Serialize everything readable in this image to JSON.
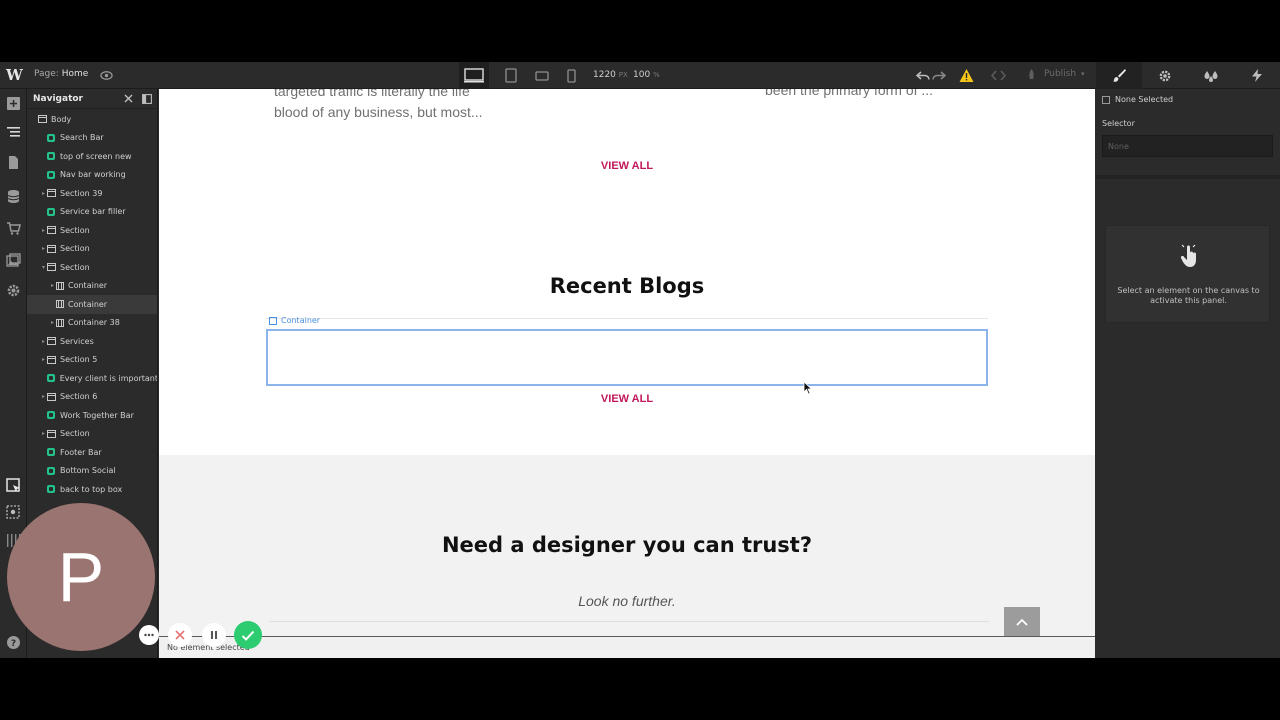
{
  "topbar": {
    "logo": "W",
    "page_prefix": "Page:",
    "page_name": "Home",
    "width_value": "1220",
    "width_unit": "PX",
    "zoom_value": "100",
    "zoom_unit": "%",
    "publish_label": "Publish"
  },
  "navigator": {
    "title": "Navigator",
    "items": [
      {
        "label": "Body",
        "type": "box",
        "depth": 0,
        "caret": false
      },
      {
        "label": "Search Bar",
        "type": "symbol",
        "depth": 1,
        "caret": false
      },
      {
        "label": "top of screen new",
        "type": "symbol",
        "depth": 1,
        "caret": false
      },
      {
        "label": "Nav bar working",
        "type": "symbol",
        "depth": 1,
        "caret": false
      },
      {
        "label": "Section 39",
        "type": "box",
        "depth": 1,
        "caret": true
      },
      {
        "label": "Service bar filler",
        "type": "symbol",
        "depth": 1,
        "caret": false
      },
      {
        "label": "Section",
        "type": "box",
        "depth": 1,
        "caret": true
      },
      {
        "label": "Section",
        "type": "box",
        "depth": 1,
        "caret": true
      },
      {
        "label": "Section",
        "type": "box",
        "depth": 1,
        "caret": true,
        "open": true
      },
      {
        "label": "Container",
        "type": "container",
        "depth": 2,
        "caret": true
      },
      {
        "label": "Container",
        "type": "container",
        "depth": 2,
        "caret": false,
        "selected": true
      },
      {
        "label": "Container 38",
        "type": "container",
        "depth": 2,
        "caret": true
      },
      {
        "label": "Services",
        "type": "box",
        "depth": 1,
        "caret": true
      },
      {
        "label": "Section 5",
        "type": "box",
        "depth": 1,
        "caret": true
      },
      {
        "label": "Every client is important",
        "type": "symbol",
        "depth": 1,
        "caret": false
      },
      {
        "label": "Section 6",
        "type": "box",
        "depth": 1,
        "caret": true
      },
      {
        "label": "Work Together Bar",
        "type": "symbol",
        "depth": 1,
        "caret": false
      },
      {
        "label": "Section",
        "type": "box",
        "depth": 1,
        "caret": true
      },
      {
        "label": "Footer Bar",
        "type": "symbol",
        "depth": 1,
        "caret": false
      },
      {
        "label": "Bottom Social",
        "type": "symbol",
        "depth": 1,
        "caret": false
      },
      {
        "label": "back to top box",
        "type": "symbol",
        "depth": 1,
        "caret": false
      }
    ]
  },
  "canvas": {
    "fragment_left_1": "targeted traffic is literally the life",
    "fragment_left_2": "blood of any business, but most...",
    "fragment_right": "been the primary form of ...",
    "view_all_1": "VIEW ALL",
    "recent_blogs": "Recent Blogs",
    "container_tag": "Container",
    "view_all_2": "VIEW ALL",
    "cta_heading": "Need a designer you can trust?",
    "cta_sub": "Look no further.",
    "status_text": "No element selected"
  },
  "right_panel": {
    "none_selected": "None Selected",
    "selector_label": "Selector",
    "selector_placeholder": "None",
    "hint": "Select an element on the canvas to activate this panel."
  },
  "recorder": {
    "avatar_letter": "P"
  },
  "colors": {
    "accent_pink": "#c2185b",
    "symbol_green": "#23c28a",
    "selection_blue": "#8ab4ea",
    "warning_yellow": "#f5c518"
  }
}
